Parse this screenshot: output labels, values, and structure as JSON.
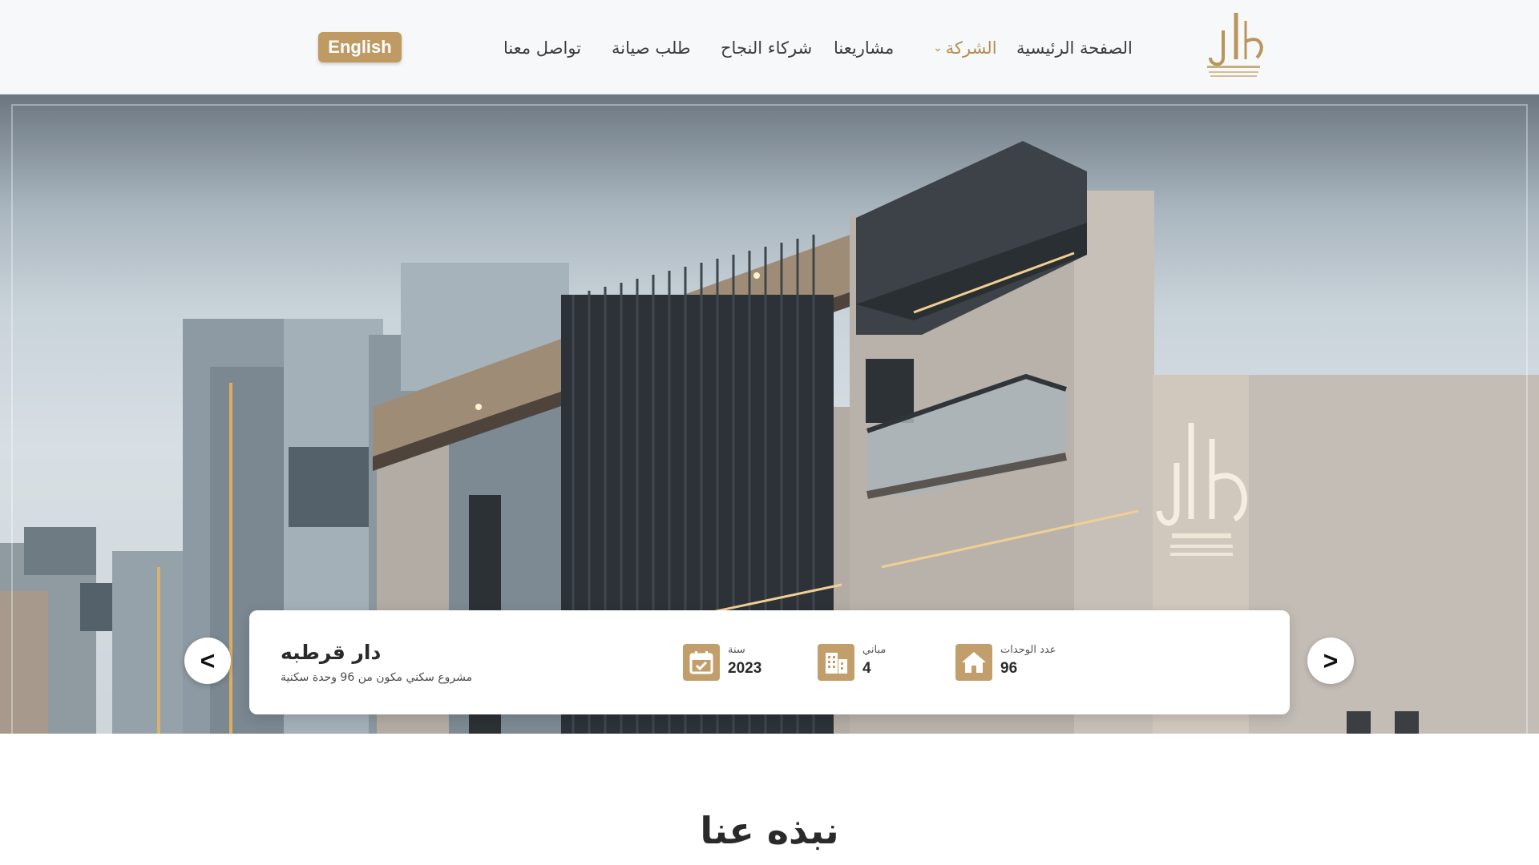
{
  "header": {
    "logo_icon": "dar-logo-icon",
    "nav": [
      {
        "label": "الصفحة الرئيسية",
        "active": false
      },
      {
        "label": "الشركة",
        "active": true,
        "has_dropdown": true
      },
      {
        "label": "مشاريعنا",
        "active": false
      },
      {
        "label": "شركاء النجاح",
        "active": false
      },
      {
        "label": "طلب صيانة",
        "active": false
      },
      {
        "label": "تواصل معنا",
        "active": false
      }
    ],
    "dropdown_icon": "chevron-down-icon",
    "language_button": "English"
  },
  "hero": {
    "slide": {
      "title": "دار قرطبه",
      "description": "مشروع سكني مكون من 96 وحدة سكنية",
      "stats": [
        {
          "label": "عدد الوحدات",
          "value": "96",
          "icon": "house-icon"
        },
        {
          "label": "مباني",
          "value": "4",
          "icon": "building-icon"
        },
        {
          "label": "سنة",
          "value": "2023",
          "icon": "calendar-icon"
        }
      ]
    },
    "prev_arrow": "<",
    "next_arrow": ">"
  },
  "about": {
    "title": "نبذه عنا"
  },
  "colors": {
    "accent": "#bf9a62",
    "nav_active": "#b38d4f",
    "header_bg": "#f7f8f9"
  }
}
